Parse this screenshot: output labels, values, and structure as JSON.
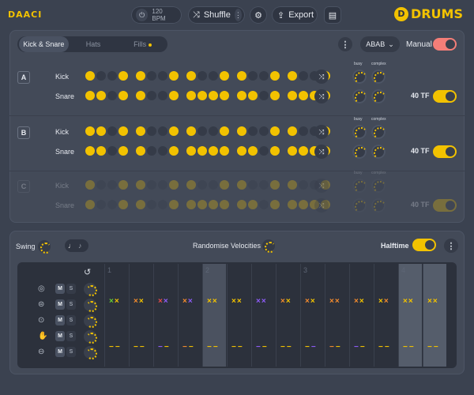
{
  "topbar": {
    "logo_left": "DAACI",
    "tempo": "120 BPM",
    "shuffle_label": "Shuffle",
    "export_label": "Export",
    "brand": "DRUMS",
    "brand_mark": "D"
  },
  "pattern_panel": {
    "tabs": [
      "Kick & Snare",
      "Hats",
      "Fills"
    ],
    "active_tab": "Kick & Snare",
    "sequence": "ABAB",
    "manual_label": "Manual",
    "manual_on": true,
    "knob_labels": {
      "busy": "busy",
      "complex": "complex"
    },
    "sections": [
      {
        "letter": "A",
        "rows": [
          {
            "label": "Kick",
            "steps": [
              1,
              0,
              0,
              1,
              1,
              0,
              0,
              1,
              1,
              0,
              0,
              1,
              1,
              0,
              0,
              1,
              1,
              0,
              0,
              1
            ]
          },
          {
            "label": "Snare",
            "steps": [
              1,
              1,
              0,
              1,
              1,
              0,
              0,
              1,
              1,
              1,
              1,
              1,
              1,
              1,
              0,
              1,
              1,
              1,
              1,
              1
            ]
          }
        ],
        "tf_label": "40 TF",
        "tf_on": true
      },
      {
        "letter": "B",
        "rows": [
          {
            "label": "Kick",
            "steps": [
              1,
              1,
              0,
              1,
              1,
              0,
              0,
              1,
              1,
              0,
              0,
              1,
              1,
              0,
              0,
              1,
              1,
              0,
              0,
              1
            ]
          },
          {
            "label": "Snare",
            "steps": [
              1,
              1,
              0,
              1,
              1,
              0,
              0,
              1,
              1,
              1,
              1,
              1,
              1,
              1,
              0,
              1,
              1,
              1,
              1,
              1
            ]
          }
        ],
        "tf_label": "40 TF",
        "tf_on": true
      },
      {
        "letter": "C",
        "rows": [
          {
            "label": "Kick",
            "steps": [
              1,
              0,
              0,
              1,
              1,
              0,
              0,
              1,
              1,
              0,
              0,
              1,
              1,
              0,
              0,
              1,
              1,
              0,
              0,
              1
            ]
          },
          {
            "label": "Snare",
            "steps": [
              1,
              0,
              0,
              1,
              1,
              0,
              0,
              1,
              1,
              1,
              1,
              1,
              1,
              1,
              0,
              1,
              1,
              1,
              1,
              1
            ]
          }
        ],
        "tf_label": "40 TF",
        "tf_on": false
      }
    ]
  },
  "groove_panel": {
    "swing_label": "Swing",
    "randomise_label": "Randomise Velocities",
    "halftime_label": "Halftime",
    "halftime_on": true,
    "lanes": [
      {
        "icon": "cymbal-icon",
        "glyph": "◎",
        "mute": "M",
        "solo": "S"
      },
      {
        "icon": "snare-drum-icon",
        "glyph": "⊜",
        "mute": "M",
        "solo": "S"
      },
      {
        "icon": "tom-icon",
        "glyph": "⊙",
        "mute": "M",
        "solo": "S"
      },
      {
        "icon": "hand-icon",
        "glyph": "✋",
        "mute": "M",
        "solo": "S"
      },
      {
        "icon": "kick-drum-icon",
        "glyph": "⊖",
        "mute": "M",
        "solo": "S"
      }
    ],
    "bar_numbers": [
      "1",
      "2",
      "3",
      "4"
    ],
    "columns": [
      {
        "hits": [
          {
            "t": "×",
            "c": "#66cc33"
          },
          {
            "t": "×",
            "c": "#f2c200"
          }
        ],
        "dash": [
          {
            "t": "−",
            "c": "#f2c200"
          },
          {
            "t": "−",
            "c": "#f2c200"
          }
        ]
      },
      {
        "hits": [
          {
            "t": "×",
            "c": "#f28a2e"
          },
          {
            "t": "×",
            "c": "#f2c200"
          }
        ],
        "dash": [
          {
            "t": "−",
            "c": "#f2c200"
          },
          {
            "t": "−",
            "c": "#f2c200"
          }
        ]
      },
      {
        "hits": [
          {
            "t": "×",
            "c": "#e84a4a"
          },
          {
            "t": "×",
            "c": "#8e5cf7"
          }
        ],
        "dash": [
          {
            "t": "−",
            "c": "#8e5cf7"
          },
          {
            "t": "−",
            "c": "#f2c200"
          }
        ]
      },
      {
        "hits": [
          {
            "t": "×",
            "c": "#f28a2e"
          },
          {
            "t": "×",
            "c": "#8e5cf7"
          }
        ],
        "dash": [
          {
            "t": "−",
            "c": "#f28a2e"
          },
          {
            "t": "−",
            "c": "#f2c200"
          }
        ]
      },
      {
        "hits": [
          {
            "t": "×",
            "c": "#f2c200"
          },
          {
            "t": "×",
            "c": "#f2c200"
          }
        ],
        "dash": [
          {
            "t": "−",
            "c": "#f2c200"
          },
          {
            "t": "−",
            "c": "#f2c200"
          }
        ]
      },
      {
        "hits": [
          {
            "t": "×",
            "c": "#f2c200"
          },
          {
            "t": "×",
            "c": "#f2c200"
          }
        ],
        "dash": [
          {
            "t": "−",
            "c": "#f2c200"
          },
          {
            "t": "−",
            "c": "#f2c200"
          }
        ]
      },
      {
        "hits": [
          {
            "t": "×",
            "c": "#8e5cf7"
          },
          {
            "t": "×",
            "c": "#8e5cf7"
          }
        ],
        "dash": [
          {
            "t": "−",
            "c": "#8e5cf7"
          },
          {
            "t": "−",
            "c": "#f2c200"
          }
        ]
      },
      {
        "hits": [
          {
            "t": "×",
            "c": "#f28a2e"
          },
          {
            "t": "×",
            "c": "#f2c200"
          }
        ],
        "dash": [
          {
            "t": "−",
            "c": "#f2c200"
          },
          {
            "t": "−",
            "c": "#f2c200"
          }
        ]
      },
      {
        "hits": [
          {
            "t": "×",
            "c": "#f28a2e"
          },
          {
            "t": "×",
            "c": "#f2c200"
          }
        ],
        "dash": [
          {
            "t": "−",
            "c": "#f2c200"
          },
          {
            "t": "−",
            "c": "#8e5cf7"
          }
        ]
      },
      {
        "hits": [
          {
            "t": "×",
            "c": "#f28a2e"
          },
          {
            "t": "×",
            "c": "#f28a2e"
          }
        ],
        "dash": [
          {
            "t": "−",
            "c": "#f28a2e"
          },
          {
            "t": "−",
            "c": "#f2c200"
          }
        ]
      },
      {
        "hits": [
          {
            "t": "×",
            "c": "#f28a2e"
          },
          {
            "t": "×",
            "c": "#f2c200"
          }
        ],
        "dash": [
          {
            "t": "−",
            "c": "#8e5cf7"
          },
          {
            "t": "−",
            "c": "#f2c200"
          }
        ]
      },
      {
        "hits": [
          {
            "t": "×",
            "c": "#f2c200"
          },
          {
            "t": "×",
            "c": "#f28a2e"
          }
        ],
        "dash": [
          {
            "t": "−",
            "c": "#f2c200"
          },
          {
            "t": "−",
            "c": "#f2c200"
          }
        ]
      },
      {
        "hits": [
          {
            "t": "×",
            "c": "#f2c200"
          },
          {
            "t": "×",
            "c": "#f2c200"
          }
        ],
        "dash": [
          {
            "t": "−",
            "c": "#f2c200"
          },
          {
            "t": "−",
            "c": "#f2c200"
          }
        ]
      },
      {
        "hits": [
          {
            "t": "×",
            "c": "#f2c200"
          },
          {
            "t": "×",
            "c": "#f2c200"
          }
        ],
        "dash": [
          {
            "t": "−",
            "c": "#f2c200"
          },
          {
            "t": "−",
            "c": "#f2c200"
          }
        ]
      }
    ]
  },
  "colors": {
    "accent": "#f2c200",
    "manual_toggle": "#f47e78",
    "background": "#3b4250"
  }
}
